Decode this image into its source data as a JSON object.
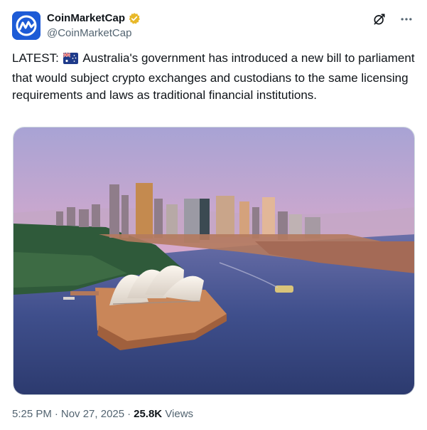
{
  "author": {
    "display_name": "CoinMarketCap",
    "handle": "@CoinMarketCap",
    "verified_badge": "gold-verified-icon",
    "avatar_color": "#1d5bd6"
  },
  "actions": {
    "grok_icon": "grok-icon",
    "more_icon": "more-horizontal-icon"
  },
  "tweet": {
    "text_prefix": "LATEST: ",
    "flag": "australia-flag-icon",
    "text_body": " Australia's government has introduced a new bill to parliament that would subject crypto exchanges and custodians to the same licensing requirements and laws as traditional financial institutions."
  },
  "media": {
    "image_subject": "Sydney harbour aerial photo",
    "sky_top": "#b8a9d6",
    "sky_bottom": "#e9a7c2",
    "water": "#3d4f8a"
  },
  "meta": {
    "time": "5:25 PM",
    "separator1": "·",
    "date": "Nov 27, 2025",
    "separator2": "·",
    "views_count": "25.8K",
    "views_label": "Views"
  }
}
